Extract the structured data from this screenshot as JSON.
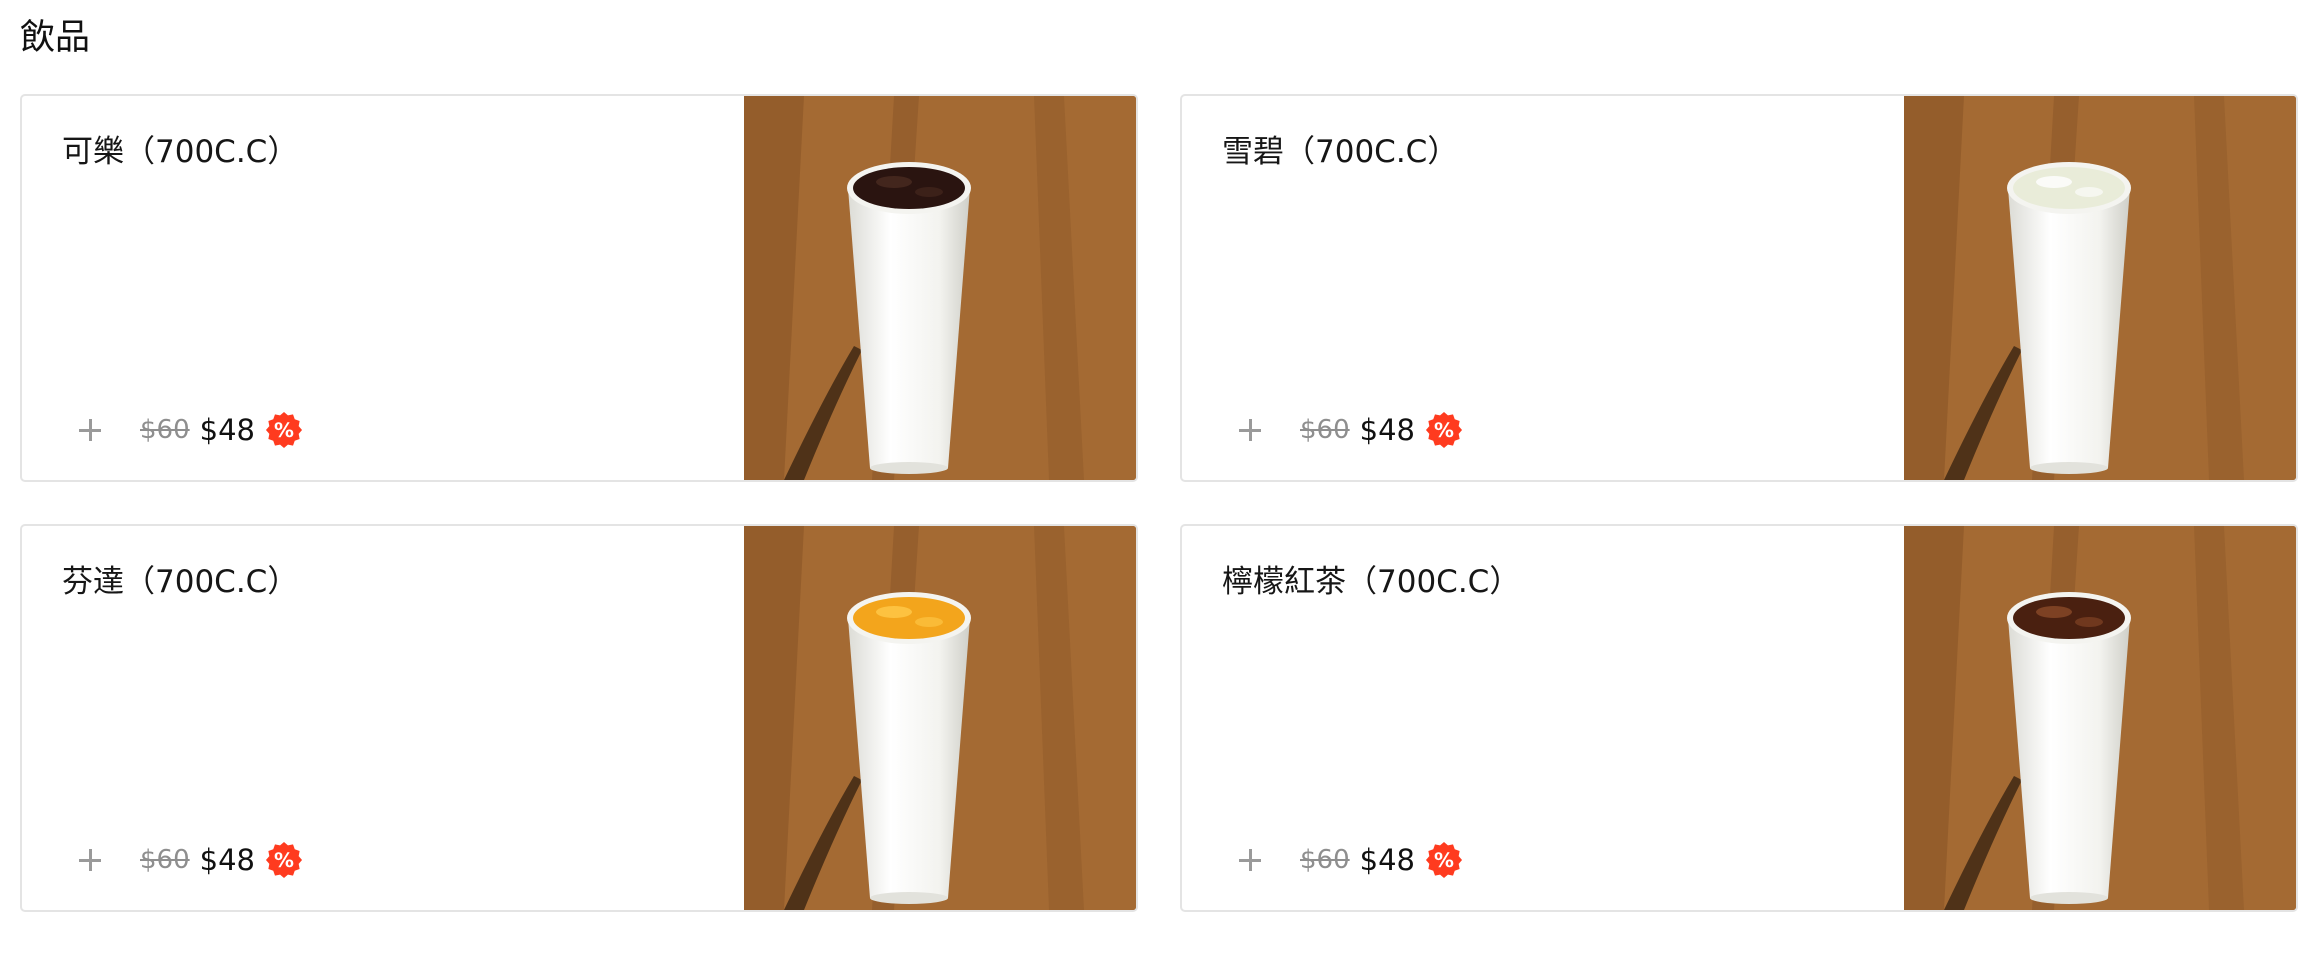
{
  "section": {
    "title": "飲品"
  },
  "items": [
    {
      "name": "可樂（700C.C）",
      "original_price": "$60",
      "sale_price": "$48",
      "badge": "%",
      "drink_color": "#2a1410",
      "drink_highlight": "#4a2a20",
      "image": "cola-cup-image"
    },
    {
      "name": "雪碧（700C.C）",
      "original_price": "$60",
      "sale_price": "$48",
      "badge": "%",
      "drink_color": "#e9ecd9",
      "drink_highlight": "#ffffff",
      "image": "sprite-cup-image"
    },
    {
      "name": "芬達（700C.C）",
      "original_price": "$60",
      "sale_price": "$48",
      "badge": "%",
      "drink_color": "#f3a51c",
      "drink_highlight": "#ffc94a",
      "image": "fanta-cup-image"
    },
    {
      "name": "檸檬紅茶（700C.C）",
      "original_price": "$60",
      "sale_price": "$48",
      "badge": "%",
      "drink_color": "#4a2010",
      "drink_highlight": "#8a4a28",
      "image": "lemon-tea-cup-image"
    }
  ],
  "colors": {
    "badge": "#ff3b1f",
    "border": "#e4e4e4",
    "wood": "#a0672f"
  },
  "icons": {
    "add": "plus-icon",
    "discount": "discount-badge-icon"
  }
}
